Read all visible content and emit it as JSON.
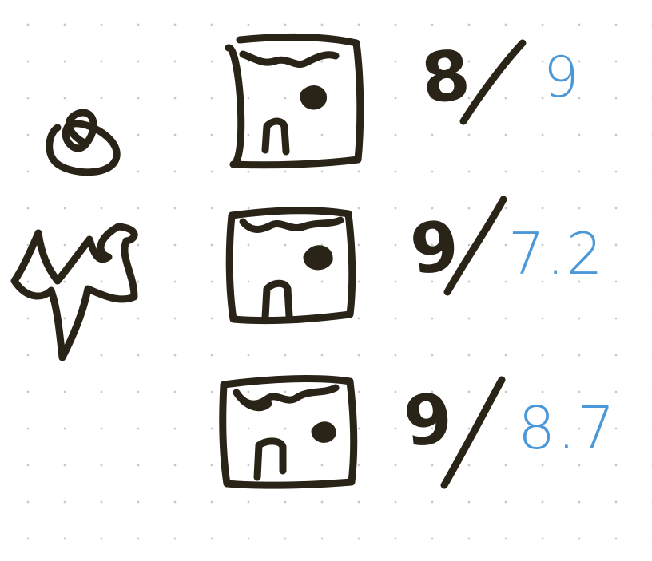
{
  "colors": {
    "ink": "#2a2418",
    "blue": "#4a98d8",
    "paper": "#ffffff",
    "dots": "#c9c9c9"
  },
  "rows": [
    {
      "glyph": "8",
      "blue_value": "9"
    },
    {
      "glyph": "9",
      "blue_value": "7.2"
    },
    {
      "glyph": "9",
      "blue_value": "8.7"
    }
  ]
}
